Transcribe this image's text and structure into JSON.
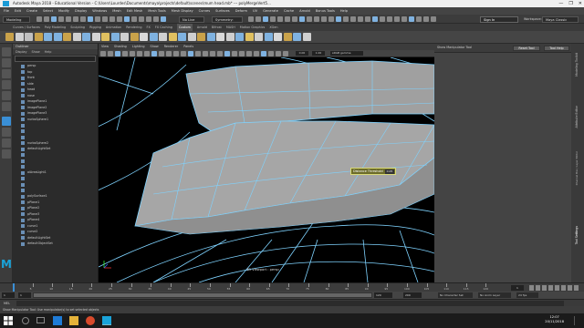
{
  "window": {
    "title": "Autodesk Maya 2018 - Educational Version - C:\\Users\\Lourdes\\Documents\\maya\\projects\\default\\scenes\\mum head.mb* --- polyMergeVert5...",
    "controls": [
      "—",
      "❐",
      "✕"
    ]
  },
  "menubar": {
    "items": [
      "File",
      "Edit",
      "Create",
      "Select",
      "Modify",
      "Display",
      "Windows",
      "Mesh",
      "Edit Mesh",
      "Mesh Tools",
      "Mesh Display",
      "Curves",
      "Surfaces",
      "Deform",
      "UV",
      "Generate",
      "Cache",
      "Arnold",
      "Bonus Tools",
      "Help"
    ]
  },
  "statusline": {
    "mode_dropdown": "Modeling",
    "live_surface": "No Live Surface",
    "symmetry": "Symmetry: Off",
    "sign_in": "Sign In",
    "workspace_label": "Workspace:",
    "workspace_value": "Maya Classic"
  },
  "shelf": {
    "tabs": [
      "Curves / Surfaces",
      "Poly Modeling",
      "Sculpting",
      "Rigging",
      "Animation",
      "Rendering",
      "FX",
      "FX Caching",
      "Custom",
      "Arnold",
      "Bifrost",
      "MASH",
      "Motion Graphics",
      "XGen"
    ],
    "active_tab": "Custom"
  },
  "outliner": {
    "title": "Outliner",
    "menu": [
      "Display",
      "Show",
      "Help"
    ],
    "items": [
      "persp",
      "top",
      "front",
      "side",
      "head",
      "nose",
      "imagePlane1",
      "imagePlane2",
      "imagePlane3",
      "nurbsSphere1",
      "",
      "",
      "",
      "nurbsSphere2",
      "defaultLightSet",
      "",
      "",
      "",
      "aiAreaLight1",
      "",
      "",
      "",
      "polySurface1",
      "pPlane1",
      "pPlane2",
      "pPlane3",
      "pPlane4",
      "curve1",
      "curve2",
      "defaultLightSet",
      "defaultObjectSet"
    ]
  },
  "viewport": {
    "menu": [
      "View",
      "Shading",
      "Lighting",
      "Show",
      "Renderer",
      "Panels"
    ],
    "camera_label": "persp",
    "renderer_label": "Viewport 2.0",
    "field_a": "0.00",
    "field_b": "1.00",
    "color_space": "sRGB gamma",
    "hud": "3D Viewport : persp"
  },
  "tooltip": {
    "label": "Distance Threshold",
    "value": "0.05"
  },
  "manipulator": {
    "title": "Show Manipulator Tool",
    "reset_button": "Reset Tool",
    "help_button": "Tool Help"
  },
  "right_tabs": [
    "Modeling Toolkit",
    "Attribute Editor",
    "Channel Box / Layer Editor",
    "Tool Settings"
  ],
  "timeline": {
    "ticks": [
      "5",
      "10",
      "15",
      "20",
      "25",
      "30",
      "35",
      "40",
      "45",
      "50",
      "55",
      "60",
      "65",
      "70",
      "75",
      "80",
      "85",
      "90",
      "95",
      "100",
      "105",
      "110",
      "115",
      "120"
    ],
    "current_frame": "1"
  },
  "range": {
    "start": "1",
    "inner_start": "1",
    "inner_end": "120",
    "end": "120",
    "out": "200",
    "char_set": "No Character Set",
    "anim_layer": "No Anim Layer",
    "fps": "24 fps"
  },
  "mel": {
    "label": "MEL"
  },
  "helpline": {
    "text": "Show Manipulator Tool: Use manipulator(s) to set selected objects"
  },
  "taskbar": {
    "time": "12:07",
    "date": "20/11/2018"
  },
  "colors": {
    "wire": "#7fd3ff",
    "surface": "#9d9d9d",
    "accent_blue": "#3a8fd6"
  }
}
